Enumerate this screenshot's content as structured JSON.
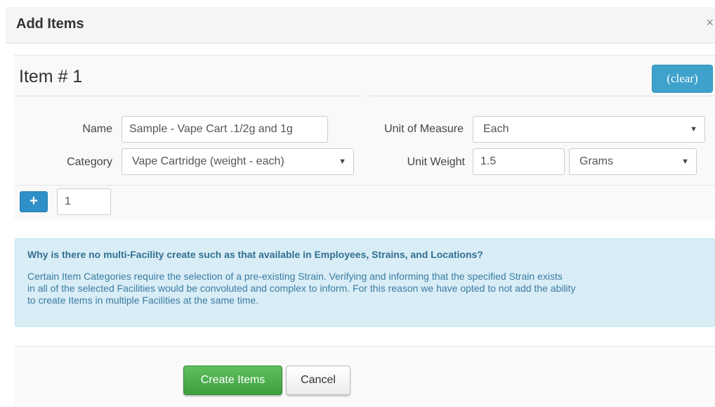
{
  "modal": {
    "title": "Add Items",
    "close_glyph": "×"
  },
  "item": {
    "heading": "Item # 1",
    "clear_label": "(clear)",
    "name_label": "Name",
    "name_value": "Sample - Vape Cart .1/2g and 1g",
    "category_label": "Category",
    "category_value": "Vape Cartridge (weight - each)",
    "uom_label": "Unit of Measure",
    "uom_value": "Each",
    "weight_label": "Unit Weight",
    "weight_value": "1.5",
    "weight_unit_value": "Grams",
    "add_glyph": "+",
    "count_value": "1",
    "dropdown_arrow": "▼"
  },
  "info": {
    "title": "Why is there no multi-Facility create such as that available in Employees, Strains, and Locations?",
    "body_line1": "Certain Item Categories require the selection of a pre-existing Strain. Verifying and informing that the specified Strain exists",
    "body_line2": "in all of the selected Facilities would be convoluted and complex to inform. For this reason we have opted to not add the ability",
    "body_line3": "to create Items in multiple Facilities at the same time."
  },
  "footer": {
    "create_label": "Create Items",
    "cancel_label": "Cancel"
  },
  "colors": {
    "primary": "#3ea2cc",
    "success": "#4cae4c",
    "info_bg": "#d9edf7",
    "info_text": "#31708f"
  },
  "icons": {
    "close": "close-icon",
    "add": "plus-icon",
    "dropdown": "chevron-down-icon"
  }
}
